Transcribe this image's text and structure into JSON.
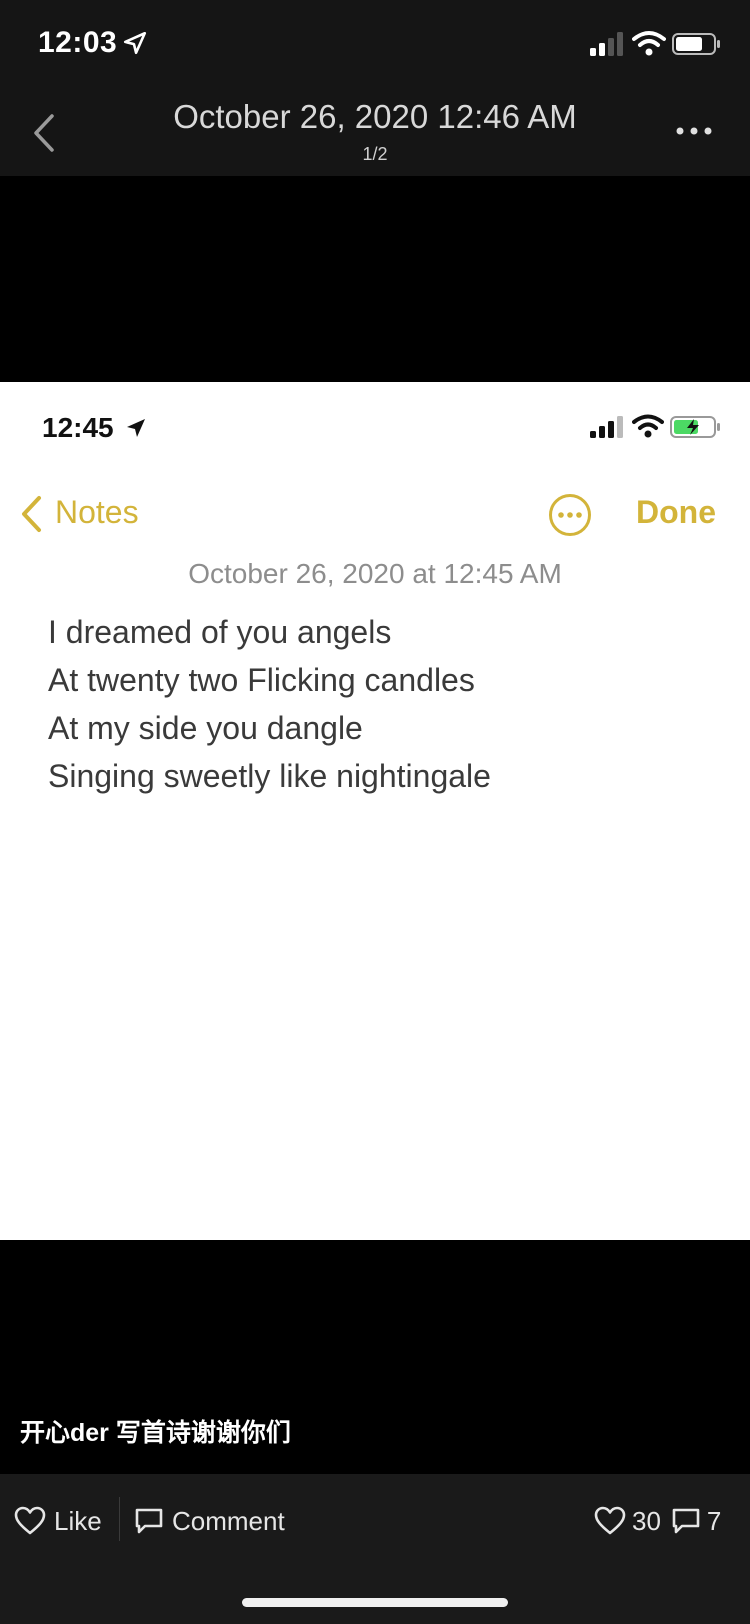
{
  "status_bar": {
    "time": "12:03"
  },
  "viewer": {
    "title": "October 26, 2020 12:46 AM",
    "counter": "1/2"
  },
  "note_screenshot": {
    "status_time": "12:45",
    "back_label": "Notes",
    "done_label": "Done",
    "date": "October 26, 2020 at 12:45 AM",
    "lines": [
      "I dreamed of you angels",
      "At twenty two Flicking candles",
      "At my side you dangle",
      "Singing sweetly like nightingale"
    ],
    "accent_color": "#d3b43a"
  },
  "caption": "开心der 写首诗谢谢你们",
  "actions": {
    "like_label": "Like",
    "comment_label": "Comment",
    "like_count": "30",
    "comment_count": "7"
  },
  "icons": [
    "location-arrow-icon",
    "signal-icon",
    "wifi-icon",
    "battery-icon",
    "chevron-left-icon",
    "more-horizontal-icon",
    "heart-icon",
    "comment-icon"
  ]
}
